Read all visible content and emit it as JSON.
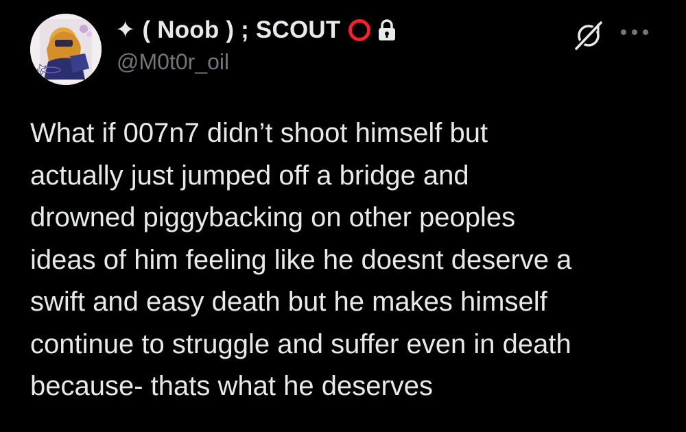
{
  "author": {
    "display_name": "✦ ( Noob ) ; SCOUT",
    "handle": "@M0t0r_oil",
    "avatar_icon": "profile-avatar",
    "ring_color": "#f4212e",
    "locked_icon": "lock-icon"
  },
  "actions": {
    "grok_icon": "grok-icon",
    "more_icon": "more-horizontal-icon"
  },
  "tweet": {
    "text": "What if 007n7 didn’t shoot himself but\nactually just jumped off a bridge and\ndrowned piggybacking on other peoples\nideas of him feeling like he doesnt deserve a\nswift and easy death but he makes himself\ncontinue to struggle and suffer even in death\nbecause- thats what he deserves"
  },
  "colors": {
    "background": "#000000",
    "text": "#e7e9ea",
    "secondary": "#71767b"
  }
}
